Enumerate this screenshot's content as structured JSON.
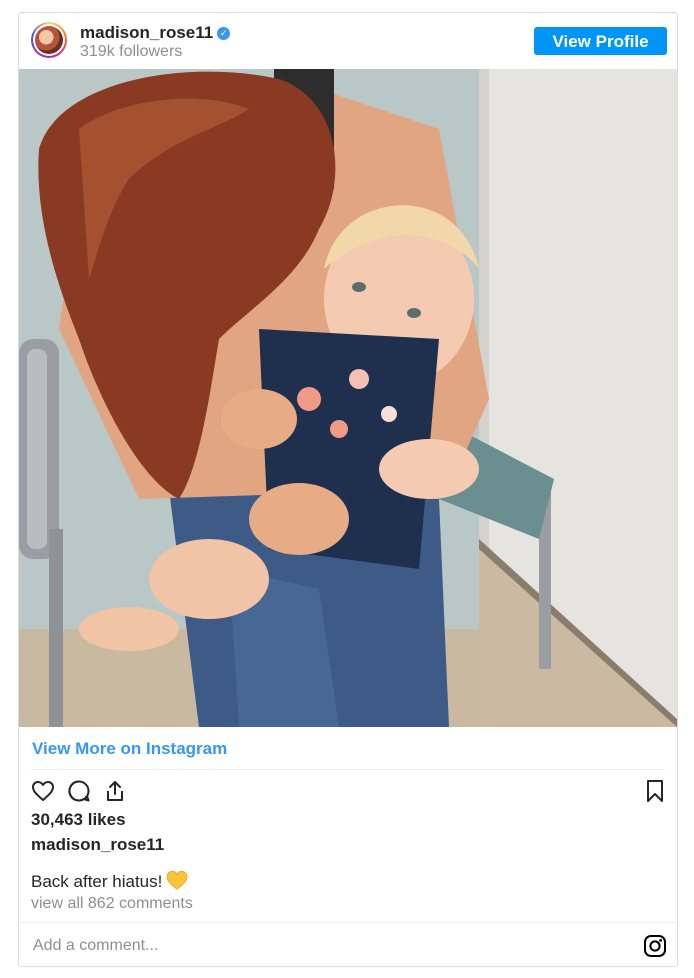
{
  "header": {
    "username": "madison_rose11",
    "verified_icon": "verified-badge-icon",
    "followers": "319k followers",
    "view_profile_label": "View Profile"
  },
  "photo": {
    "description_icon": "post-photo"
  },
  "links": {
    "view_more": "View More on Instagram"
  },
  "actions": {
    "like_icon": "heart-icon",
    "comment_icon": "comment-icon",
    "share_icon": "share-icon",
    "save_icon": "bookmark-icon"
  },
  "post": {
    "likes": "30,463 likes",
    "owner": "madison_rose11",
    "caption": "Back after hiatus!",
    "caption_emoji": "yellow-heart-emoji",
    "view_comments": "view all 862 comments"
  },
  "comment_box": {
    "placeholder": "Add a comment..."
  },
  "colors": {
    "accent": "#0095f6",
    "link": "#3897f0",
    "muted": "#8e8e8e",
    "text": "#262626",
    "border": "#dbdbdb"
  }
}
